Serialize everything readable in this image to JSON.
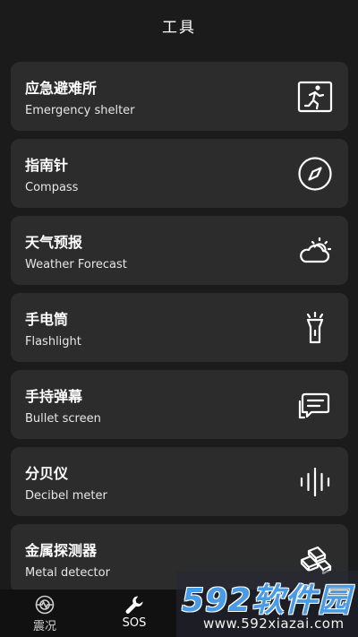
{
  "header": {
    "title": "工具"
  },
  "tools": [
    {
      "title": "应急避难所",
      "subtitle": "Emergency shelter",
      "icon": "running-exit-icon"
    },
    {
      "title": "指南针",
      "subtitle": "Compass",
      "icon": "compass-icon"
    },
    {
      "title": "天气预报",
      "subtitle": "Weather Forecast",
      "icon": "weather-icon"
    },
    {
      "title": "手电筒",
      "subtitle": "Flashlight",
      "icon": "flashlight-icon"
    },
    {
      "title": "手持弹幕",
      "subtitle": "Bullet screen",
      "icon": "message-icon"
    },
    {
      "title": "分贝仪",
      "subtitle": "Decibel meter",
      "icon": "sound-wave-icon"
    },
    {
      "title": "金属探测器",
      "subtitle": "Metal detector",
      "icon": "metal-bars-icon"
    }
  ],
  "tabbar": {
    "tabs": [
      {
        "label": "震况",
        "icon": "earthquake-icon"
      },
      {
        "label": "SOS",
        "icon": "wrench-icon",
        "active": true
      }
    ]
  },
  "watermark": {
    "title": "592软件园",
    "url": "www.592xiazai.com"
  },
  "colors": {
    "background": "#1b1b1b",
    "card": "#2c2c2c",
    "tabbar": "#111111",
    "watermark_blue": "#4a9be6"
  }
}
